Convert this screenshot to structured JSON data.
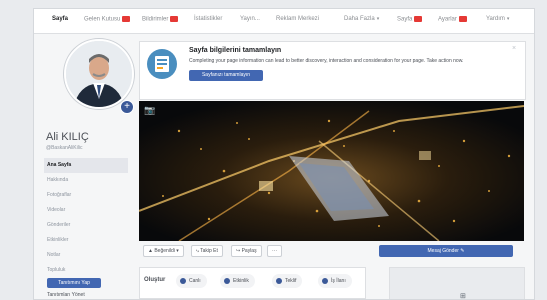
{
  "topnav": {
    "tabs": [
      {
        "label": "Sayfa",
        "active": true,
        "badge": false,
        "dropdown": false
      },
      {
        "label": "Gelen Kutusu",
        "active": false,
        "badge": true,
        "dropdown": false
      },
      {
        "label": "Bildirimler",
        "active": false,
        "badge": true,
        "dropdown": false
      },
      {
        "label": "İstatistikler",
        "active": false,
        "badge": false,
        "dropdown": false
      },
      {
        "label": "Yayın...",
        "active": false,
        "badge": false,
        "dropdown": false
      },
      {
        "label": "Reklam Merkezi",
        "active": false,
        "badge": false,
        "dropdown": false
      },
      {
        "label": "Daha Fazla",
        "active": false,
        "badge": false,
        "dropdown": true
      },
      {
        "label": "Sayfa",
        "active": false,
        "badge": true,
        "dropdown": false
      },
      {
        "label": "Ayarlar",
        "active": false,
        "badge": true,
        "dropdown": false
      },
      {
        "label": "Yardım",
        "active": false,
        "badge": false,
        "dropdown": true
      }
    ]
  },
  "profile": {
    "name": "Ali KILIÇ",
    "handle": "@BaskanAliKilic",
    "menu": [
      "Ana Sayfa",
      "Hakkında",
      "Fotoğraflar",
      "Videolar",
      "Gönderiler",
      "Etkinlikler",
      "Notlar",
      "Topluluk"
    ],
    "promote_label": "Tanıtımını Yap",
    "manage_label": "Tanıtımları Yönet"
  },
  "setup_card": {
    "title": "Sayfa bilgilerini tamamlayın",
    "description": "Completing your page information can lead to better discovery, interaction and consideration for your page. Take action now.",
    "button_label": "Sayfanızı tamamlayın",
    "close_glyph": "×"
  },
  "cover": {
    "camera_glyph": "📷",
    "description_icon": "night-city-aerial-photo"
  },
  "actions": {
    "liked_label": "▲ Beğenildi ▾",
    "following_label": "⤷ Takip Et",
    "share_label": "↪ Paylaş",
    "more_label": "···",
    "message_label": "Mesaj Gönder ✎"
  },
  "composer": {
    "label": "Oluştur",
    "buttons": [
      {
        "label": "Canlı",
        "color": "#3b5998"
      },
      {
        "label": "Etkinlik",
        "color": "#3b5998"
      },
      {
        "label": "Teklif",
        "color": "#3b5998"
      },
      {
        "label": "İş İlanı",
        "color": "#3b5998"
      }
    ]
  },
  "right_card": {
    "icon_glyph": "⊞"
  },
  "colors": {
    "brand": "#4267b2",
    "badge": "#e53935"
  }
}
